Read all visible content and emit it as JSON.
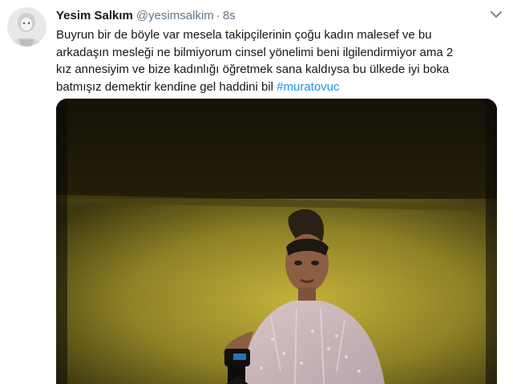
{
  "tweet": {
    "author_name": "Yesim Salkım",
    "author_handle": "@yesimsalkim",
    "separator": "·",
    "time": "8s",
    "text_lines": [
      "Buyrun bir de böyle var mesela takipçilerinin çoğu kadın malesef ve bu",
      "arkadaşın mesleği ne bilmiyorum cinsel yönelimi beni ilgilendirmiyor ama 2",
      "kız annesiyim ve bize kadınlığı öğretmek sana kaldıysa bu ülkede iyi boka"
    ],
    "text_last_line": "batmışız demektir kendine gel haddini bil",
    "hashtag": "#muratovuc",
    "icons": {
      "avatar": "profile-photo",
      "menu": "chevron-down-icon",
      "media": "video-thumbnail"
    },
    "colors": {
      "text": "#14171a",
      "secondary": "#657786",
      "link": "#1b95e0"
    }
  }
}
